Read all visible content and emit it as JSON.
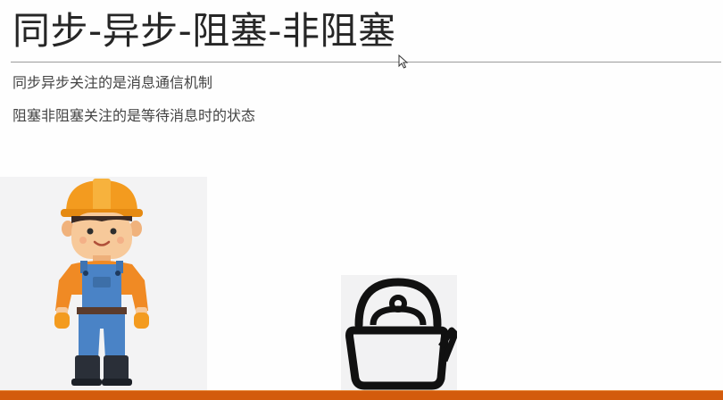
{
  "slide": {
    "title": "同步-异步-阻塞-非阻塞",
    "lines": [
      "同步异步关注的是消息通信机制",
      "阻塞非阻塞关注的是等待消息时的状态"
    ]
  },
  "images": {
    "worker": "construction-worker-illustration",
    "kettle": "kettle-icon"
  },
  "colors": {
    "bottom_band": "#d35b0c",
    "helmet": "#f39b1f",
    "overalls": "#4a83c6",
    "skin": "#f7c99a",
    "kettle_outline": "#111111"
  }
}
